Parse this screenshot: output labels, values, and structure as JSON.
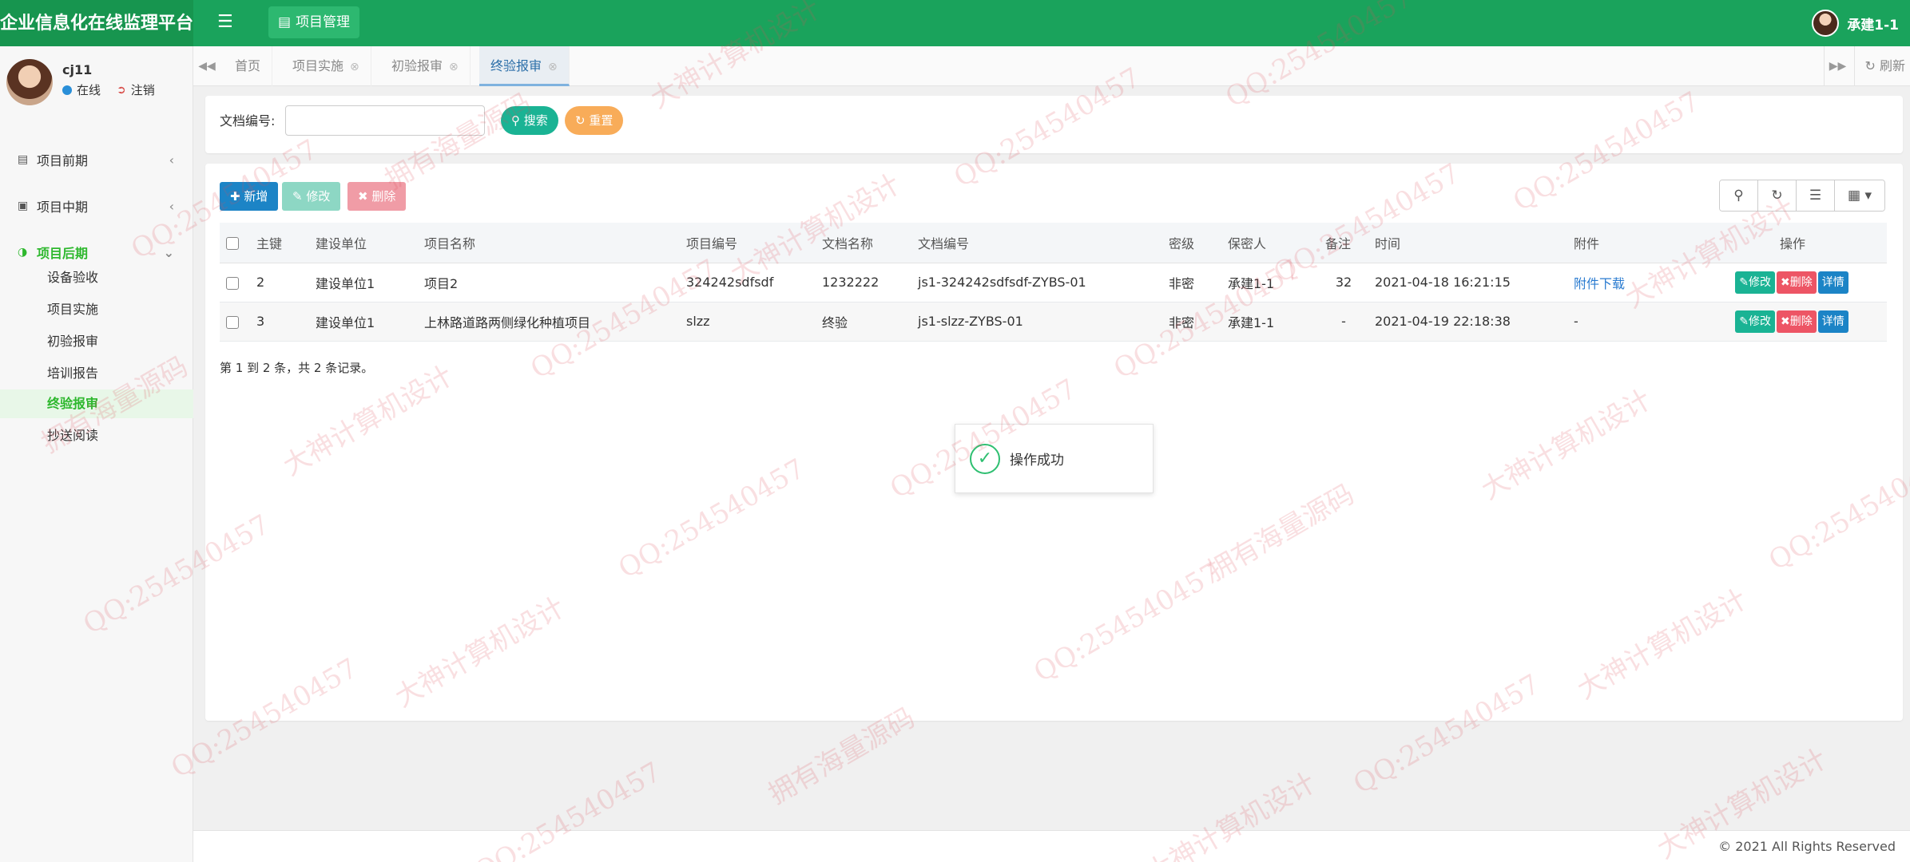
{
  "app": {
    "title": "企业信息化在线监理平台",
    "module": "项目管理",
    "user": "承建1-1"
  },
  "sidebar": {
    "user": {
      "name": "cj11",
      "status": "在线",
      "logout": "注销"
    },
    "groups": [
      {
        "label": "项目前期"
      },
      {
        "label": "项目中期"
      },
      {
        "label": "项目后期"
      }
    ],
    "subitems": [
      "设备验收",
      "项目实施",
      "初验报审",
      "培训报告",
      "终验报审",
      "抄送阅读"
    ]
  },
  "tabs": {
    "items": [
      "首页",
      "项目实施",
      "初验报审",
      "终验报审"
    ],
    "refresh": "刷新"
  },
  "search": {
    "label": "文档编号:",
    "value": "",
    "placeholder": "",
    "search_btn": "搜索",
    "reset_btn": "重置"
  },
  "toolbar": {
    "add": "新增",
    "edit": "修改",
    "delete": "删除"
  },
  "table": {
    "headers": [
      "主键",
      "建设单位",
      "项目名称",
      "项目编号",
      "文档名称",
      "文档编号",
      "密级",
      "保密人",
      "备注",
      "时间",
      "附件",
      "操作"
    ],
    "rows": [
      {
        "id": "2",
        "unit": "建设单位1",
        "project": "项目2",
        "code": "324242sdfsdf",
        "doc": "1232222",
        "docno": "js1-324242sdfsdf-ZYBS-01",
        "level": "非密",
        "keeper": "承建1-1",
        "note": "32",
        "time": "2021-04-18 16:21:15",
        "attach": "附件下载"
      },
      {
        "id": "3",
        "unit": "建设单位1",
        "project": "上林路道路两侧绿化种植项目",
        "code": "slzz",
        "doc": "终验",
        "docno": "js1-slzz-ZYBS-01",
        "level": "非密",
        "keeper": "承建1-1",
        "note": "-",
        "time": "2021-04-19 22:18:38",
        "attach": "-"
      }
    ],
    "ops": {
      "edit": "修改",
      "delete": "删除",
      "detail": "详情"
    }
  },
  "pager": {
    "text": "第 1 到 2 条，共 2 条记录。"
  },
  "toast": {
    "message": "操作成功"
  },
  "footer": {
    "copyright": "© 2021 All Rights Reserved"
  },
  "watermark": {
    "texts": [
      "QQ:254540457",
      "拥有海量源码",
      "大神计算机设计"
    ]
  },
  "colors": {
    "header": "#1aa35c",
    "primary": "#1c84c6",
    "success": "#1ab394",
    "danger": "#ed5565",
    "warning": "#f8ac59"
  }
}
